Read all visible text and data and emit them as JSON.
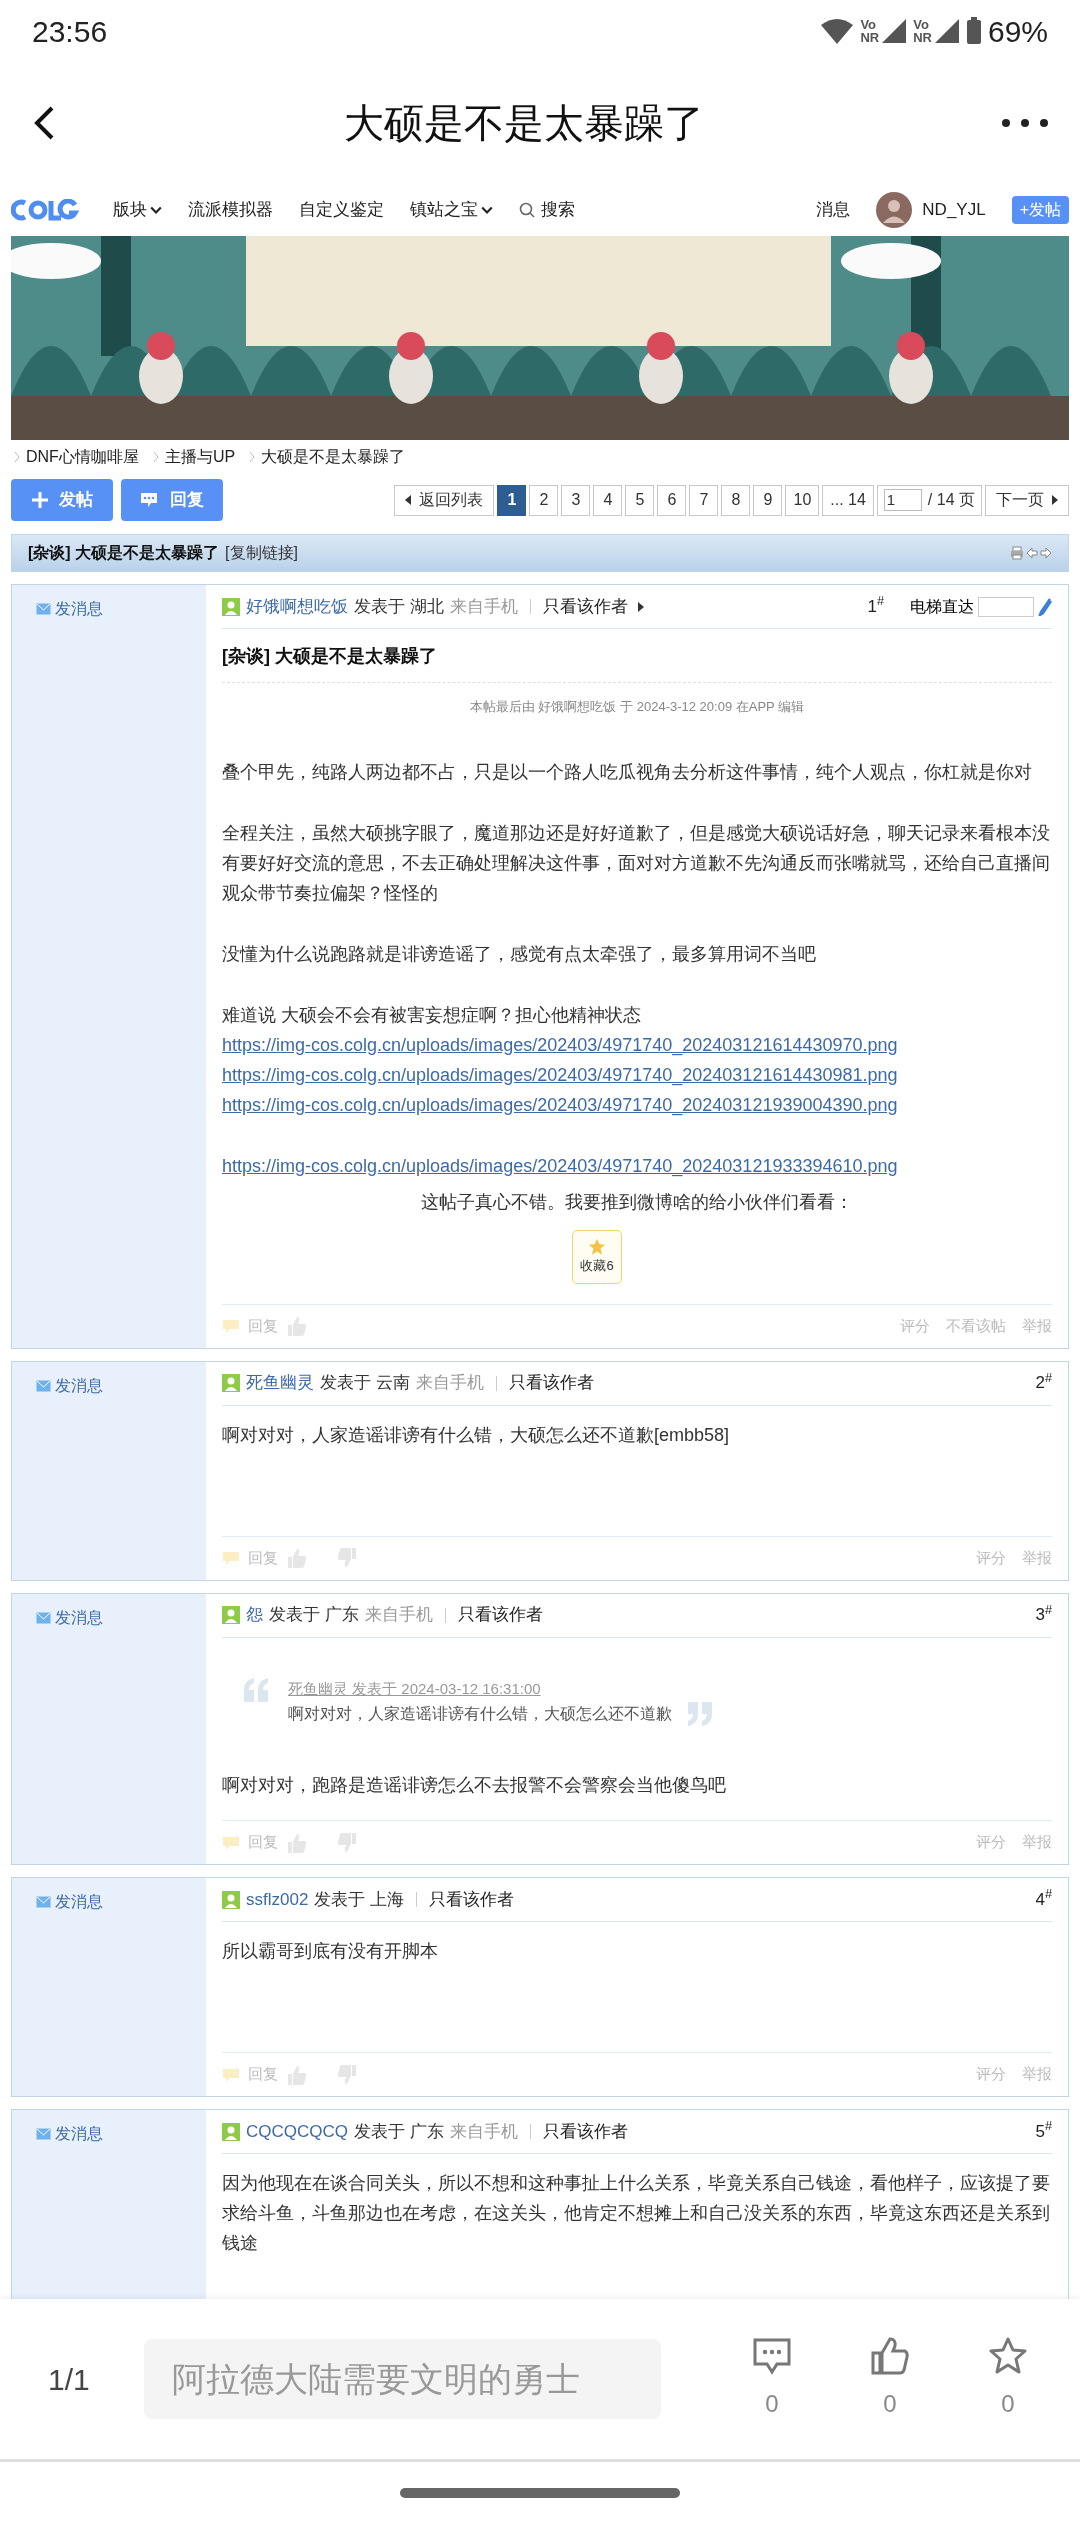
{
  "status_bar": {
    "time": "23:56",
    "networks": [
      {
        "top": "Vo",
        "bottom": "NR"
      },
      {
        "top": "Vo",
        "bottom": "NR"
      }
    ],
    "battery": "69%"
  },
  "app_bar": {
    "title": "大硕是不是太暴躁了"
  },
  "site_nav": {
    "items": [
      {
        "label": "版块",
        "kind": "dropdown"
      },
      {
        "label": "流派模拟器",
        "kind": "link"
      },
      {
        "label": "自定义鉴定",
        "kind": "link"
      },
      {
        "label": "镇站之宝",
        "kind": "dropdown"
      },
      {
        "label": "搜索",
        "kind": "search"
      }
    ],
    "message": "消息",
    "username": "ND_YJL",
    "post_button": "+发帖"
  },
  "banner": {
    "kind": "picture"
  },
  "breadcrumb": [
    "DNF心情咖啡屋",
    "主播与UP",
    "大硕是不是太暴躁了"
  ],
  "actions": {
    "new_post": "发帖",
    "reply": "回复"
  },
  "pagination": {
    "back": "返回列表",
    "pages": [
      {
        "label": "1",
        "selected": true
      },
      {
        "label": "2",
        "selected": false
      },
      {
        "label": "3",
        "selected": false
      },
      {
        "label": "4",
        "selected": false
      },
      {
        "label": "5",
        "selected": false
      },
      {
        "label": "6",
        "selected": false
      },
      {
        "label": "7",
        "selected": false
      },
      {
        "label": "8",
        "selected": false
      },
      {
        "label": "9",
        "selected": false
      },
      {
        "label": "10",
        "selected": false
      },
      {
        "label": "... 14",
        "selected": false
      }
    ],
    "page_input": "1",
    "total": "/ 14 页",
    "next": "下一页"
  },
  "thread_header": {
    "title": "[杂谈] 大硕是不是太暴躁了",
    "copy_link": "[复制链接]"
  },
  "posts": [
    {
      "send_message": "发消息",
      "author": "好饿啊想吃饭",
      "posted": "发表于 湖北",
      "from": "来自手机",
      "only_author": "只看该作者",
      "only_author_arrow": true,
      "floor": "1$^{#}$",
      "jump": {
        "label": "电梯直达"
      },
      "title": "[杂谈] 大硕是不是太暴躁了",
      "edit_note": "本帖最后由 好饿啊想吃饭 于 2024-3-12 20:09 在APP 编辑",
      "body": [
        [
          {
            "kind": "text",
            "text": "叠个甲先，纯路人两边都不占，只是以一个路人吃瓜视角去分析这件事情，纯个人观点，你杠就是你对"
          }
        ],
        [
          {
            "kind": "text",
            "text": "全程关注，虽然大硕挑字眼了，魔道那边还是好好道歉了，但是感觉大硕说话好急，聊天记录来看根本没有要好好交流的意思，不去正确处理解决这件事，面对对方道歉不先沟通反而张嘴就骂，还给自己直播间观众带节奏拉偏架？怪怪的"
          }
        ],
        [
          {
            "kind": "text",
            "text": "没懂为什么说跑路就是诽谤造谣了，感觉有点太牵强了，最多算用词不当吧"
          }
        ],
        [
          {
            "kind": "text",
            "text": "难道说 大硕会不会有被害妄想症啊？担心他精神状态"
          },
          {
            "kind": "link",
            "text": "https://img-cos.colg.cn/uploads/images/202403/4971740_202403121614430970.png"
          },
          {
            "kind": "link",
            "text": "https://img-cos.colg.cn/uploads/images/202403/4971740_202403121614430981.png"
          },
          {
            "kind": "link",
            "text": "https://img-cos.colg.cn/uploads/images/202403/4971740_202403121939004390.png"
          }
        ],
        [
          {
            "kind": "link",
            "text": "https://img-cos.colg.cn/uploads/images/202403/4971740_202403121933394610.png"
          }
        ]
      ],
      "share_note": "这帖子真心不错。我要推到微博啥的给小伙伴们看看：",
      "favorite": "收藏6",
      "reply": "回复",
      "thumbs_down": false,
      "footer_actions": [
        "评分",
        "不看该帖",
        "举报"
      ]
    },
    {
      "send_message": "发消息",
      "author": "死鱼幽灵",
      "posted": "发表于 云南",
      "from": "来自手机",
      "only_author": "只看该作者",
      "only_author_arrow": false,
      "floor": "2$^{#}$",
      "body": [
        [
          {
            "kind": "text",
            "text": "啊对对对，人家造谣诽谤有什么错，大硕怎么还不道歉[embb58]"
          }
        ]
      ],
      "reply": "回复",
      "thumbs_down": true,
      "footer_actions": [
        "评分",
        "举报"
      ]
    },
    {
      "send_message": "发消息",
      "author": "怨",
      "posted": "发表于 广东",
      "from": "来自手机",
      "only_author": "只看该作者",
      "only_author_arrow": false,
      "floor": "3$^{#}$",
      "quote": {
        "source": "死鱼幽灵 发表于 2024-03-12 16:31:00",
        "text": "啊对对对，人家造谣诽谤有什么错，大硕怎么还不道歉"
      },
      "body": [
        [
          {
            "kind": "text",
            "text": "啊对对对，跑路是造谣诽谤怎么不去报警不会警察会当他傻鸟吧"
          }
        ]
      ],
      "reply": "回复",
      "thumbs_down": true,
      "footer_actions": [
        "评分",
        "举报"
      ]
    },
    {
      "send_message": "发消息",
      "author": "ssflz002",
      "posted": "发表于 上海",
      "only_author": "只看该作者",
      "only_author_arrow": false,
      "floor": "4$^{#}$",
      "body": [
        [
          {
            "kind": "text",
            "text": "所以霸哥到底有没有开脚本"
          }
        ]
      ],
      "reply": "回复",
      "thumbs_down": true,
      "footer_actions": [
        "评分",
        "举报"
      ]
    },
    {
      "send_message": "发消息",
      "author": "CQCQCQCQ",
      "posted": "发表于 广东",
      "from": "来自手机",
      "only_author": "只看该作者",
      "only_author_arrow": false,
      "floor": "5$^{#}$",
      "body": [
        [
          {
            "kind": "text",
            "text": "因为他现在在谈合同关头，所以不想和这种事扯上什么关系，毕竟关系自己钱途，看他样子，应该提了要求给斗鱼，斗鱼那边也在考虑，在这关头，他肯定不想摊上和自己没关系的东西，毕竟这东西还是关系到钱途"
          }
        ]
      ]
    }
  ],
  "bottom_bar": {
    "page": "1/1",
    "placeholder": "阿拉德大陆需要文明的勇士",
    "buttons": [
      {
        "kind": "comment",
        "count": "0"
      },
      {
        "kind": "like",
        "count": "0"
      },
      {
        "kind": "star",
        "count": "0"
      }
    ]
  }
}
